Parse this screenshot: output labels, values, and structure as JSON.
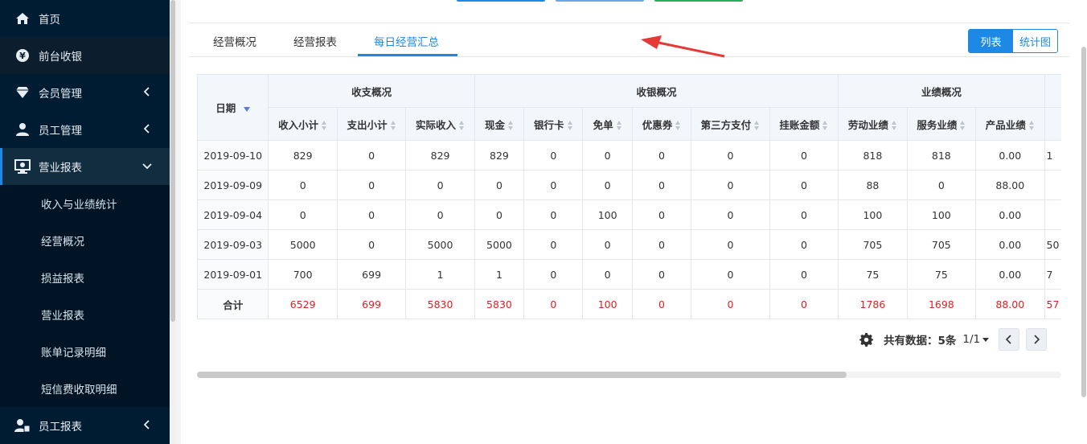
{
  "sidebar": {
    "items": [
      {
        "label": "首页"
      },
      {
        "label": "前台收银"
      },
      {
        "label": "会员管理"
      },
      {
        "label": "员工管理"
      },
      {
        "label": "营业报表"
      },
      {
        "label": "员工报表"
      }
    ],
    "sub_items": [
      {
        "label": "收入与业绩统计"
      },
      {
        "label": "经营概况"
      },
      {
        "label": "损益报表"
      },
      {
        "label": "营业报表"
      },
      {
        "label": "账单记录明细"
      },
      {
        "label": "短信费收取明细"
      }
    ]
  },
  "tabs": [
    {
      "label": "经营概况"
    },
    {
      "label": "经营报表"
    },
    {
      "label": "每日经营汇总"
    }
  ],
  "view_toggle": {
    "list": "列表",
    "chart": "统计图"
  },
  "table": {
    "date_header": "日期",
    "groups": [
      "收支概况",
      "收银概况",
      "业绩概况"
    ],
    "columns": [
      "收入小计",
      "支出小计",
      "实际收入",
      "现金",
      "银行卡",
      "免单",
      "优惠券",
      "第三方支付",
      "挂账金额",
      "劳动业绩",
      "服务业绩",
      "产品业绩",
      "业"
    ],
    "rows": [
      {
        "date": "2019-09-10",
        "cells": [
          "829",
          "0",
          "829",
          "829",
          "0",
          "0",
          "0",
          "0",
          "0",
          "818",
          "818",
          "0.00",
          "1"
        ]
      },
      {
        "date": "2019-09-09",
        "cells": [
          "0",
          "0",
          "0",
          "0",
          "0",
          "0",
          "0",
          "0",
          "0",
          "88",
          "0",
          "88.00",
          ""
        ]
      },
      {
        "date": "2019-09-04",
        "cells": [
          "0",
          "0",
          "0",
          "0",
          "0",
          "100",
          "0",
          "0",
          "0",
          "100",
          "100",
          "0.00",
          ""
        ]
      },
      {
        "date": "2019-09-03",
        "cells": [
          "5000",
          "0",
          "5000",
          "5000",
          "0",
          "0",
          "0",
          "0",
          "0",
          "705",
          "705",
          "0.00",
          "50"
        ]
      },
      {
        "date": "2019-09-01",
        "cells": [
          "700",
          "699",
          "1",
          "1",
          "0",
          "0",
          "0",
          "0",
          "0",
          "75",
          "75",
          "0.00",
          "7"
        ]
      }
    ],
    "total": {
      "label": "合计",
      "cells": [
        "6529",
        "699",
        "5830",
        "5830",
        "0",
        "100",
        "0",
        "0",
        "0",
        "1786",
        "1698",
        "88.00",
        "57"
      ]
    }
  },
  "pager": {
    "total_text": "共有数据：5条",
    "pages": "1/1"
  },
  "colors": {
    "accent": "#1e88e5",
    "sidebar_bg": "#001c33",
    "total_red": "#e02020",
    "annotation_red": "#e53935"
  }
}
